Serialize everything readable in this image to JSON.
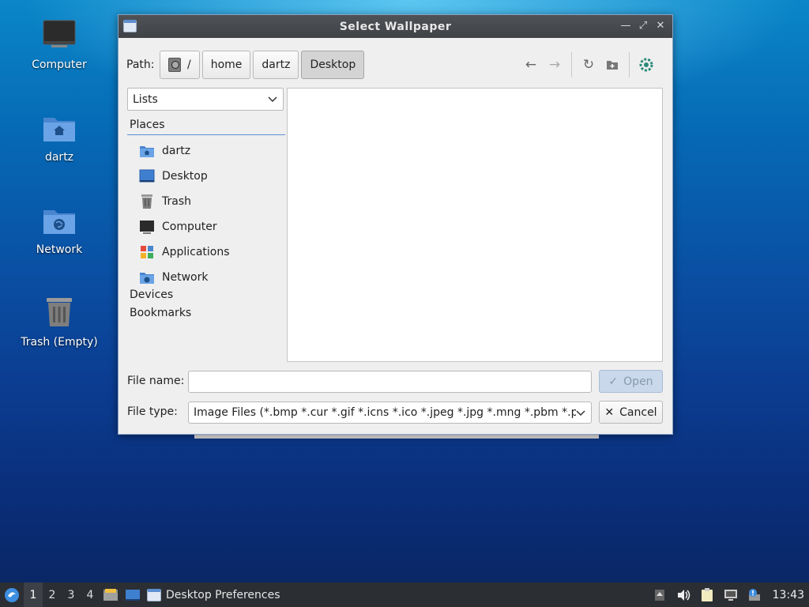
{
  "desktop": {
    "icons": [
      {
        "label": "Computer"
      },
      {
        "label": "dartz"
      },
      {
        "label": "Network"
      },
      {
        "label": "Trash (Empty)"
      }
    ]
  },
  "dialog": {
    "title": "Select Wallpaper",
    "path_label": "Path:",
    "breadcrumbs": [
      "/",
      "home",
      "dartz",
      "Desktop"
    ],
    "active_crumb": "Desktop",
    "view_select": "Lists",
    "places_header": "Places",
    "places": [
      {
        "label": "dartz",
        "icon": "home-folder-icon"
      },
      {
        "label": "Desktop",
        "icon": "desktop-icon"
      },
      {
        "label": "Trash",
        "icon": "trash-icon"
      },
      {
        "label": "Computer",
        "icon": "computer-icon"
      },
      {
        "label": "Applications",
        "icon": "applications-icon"
      },
      {
        "label": "Network",
        "icon": "network-icon"
      }
    ],
    "devices_header": "Devices",
    "bookmarks_header": "Bookmarks",
    "file_name_label": "File name:",
    "file_name_value": "",
    "file_type_label": "File type:",
    "file_type_value": "Image Files (*.bmp *.cur *.gif *.icns *.ico *.jpeg *.jpg *.mng *.pbm *.pgm",
    "open_label": "Open",
    "cancel_label": "Cancel"
  },
  "taskbar": {
    "workspaces": [
      "1",
      "2",
      "3",
      "4"
    ],
    "current_workspace": "1",
    "task_label": "Desktop Preferences",
    "clock": "13:43"
  },
  "colors": {
    "accent": "#5b8fd1",
    "titlebar": "#45484d",
    "taskbar": "#2b2e33"
  }
}
